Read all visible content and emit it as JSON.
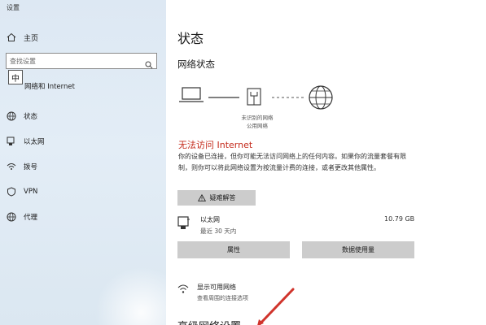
{
  "app_title": "设置",
  "sidebar": {
    "home_label": "主页",
    "search_placeholder": "查找设置",
    "ime_label": "中",
    "section_heading": "网络和 Internet",
    "items": [
      {
        "label": "状态",
        "icon": "globe-icon"
      },
      {
        "label": "以太网",
        "icon": "ethernet-icon"
      },
      {
        "label": "拨号",
        "icon": "dialup-icon"
      },
      {
        "label": "VPN",
        "icon": "vpn-shield-icon"
      },
      {
        "label": "代理",
        "icon": "proxy-globe-icon"
      }
    ]
  },
  "main": {
    "title": "状态",
    "network_status_heading": "网络状态",
    "unknown_network_label": "未识别的网络\n公用网络",
    "warning_title": "无法访问 Internet",
    "warning_description": "你的设备已连接，但你可能无法访问网络上的任何内容。如果你的流量套餐有限制，则你可以将此网络设置为按流量计费的连接，或者更改其他属性。",
    "troubleshoot_label": "疑难解答",
    "connection": {
      "name": "以太网",
      "subtitle": "最近 30 天内",
      "data_usage": "10.79 GB"
    },
    "properties_label": "属性",
    "data_usage_label": "数据使用量",
    "available_networks": {
      "title": "显示可用网络",
      "subtitle": "查看周围的连接选项"
    },
    "advanced_heading": "高级网络设置"
  },
  "colors": {
    "sidebar_bg": "#dde8f3",
    "warning_red": "#c42b1c",
    "button_gray": "#cccccc",
    "arrow_red": "#d0342c"
  }
}
